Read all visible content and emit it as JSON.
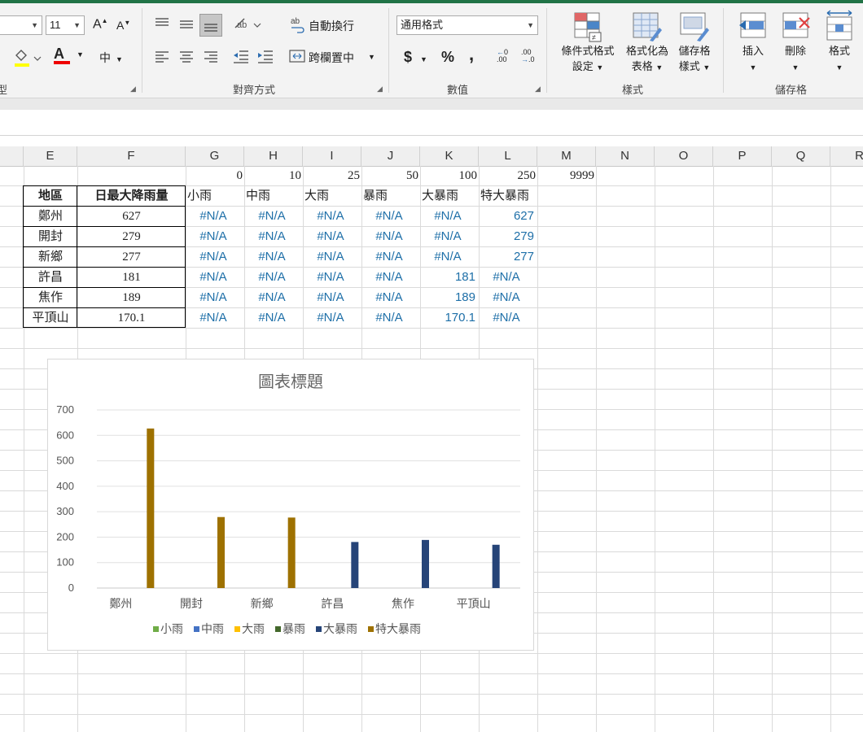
{
  "ribbon": {
    "font_size_value": "11",
    "increase_font_label": "A",
    "decrease_font_label": "A",
    "wrap_text_label": "自動換行",
    "merge_center_label": "跨欄置中",
    "number_format_value": "通用格式",
    "currency_label": "$",
    "percent_label": "%",
    "comma_label": ",",
    "inc_decimal_label": ".00",
    "dec_decimal_label": ".0",
    "phonetic_label": "中",
    "cond_format_line1": "條件式格式",
    "cond_format_line2": "設定",
    "format_table_line1": "格式化為",
    "format_table_line2": "表格",
    "cell_styles_line1": "儲存格",
    "cell_styles_line2": "樣式",
    "insert_label": "插入",
    "delete_label": "刪除",
    "format_label": "格式",
    "groups": {
      "font_partial": "型",
      "alignment": "對齊方式",
      "number": "數值",
      "styles": "樣式",
      "cells": "儲存格"
    }
  },
  "columns": [
    "E",
    "F",
    "G",
    "H",
    "I",
    "J",
    "K",
    "L",
    "M",
    "N",
    "O",
    "P",
    "Q",
    "R"
  ],
  "thresholds": [
    "0",
    "10",
    "25",
    "50",
    "100",
    "250",
    "9999"
  ],
  "table": {
    "header_region": "地區",
    "header_rain": "日最大降雨量",
    "category_headers": [
      "小雨",
      "中雨",
      "大雨",
      "暴雨",
      "大暴雨",
      "特大暴雨"
    ],
    "rows": [
      {
        "region": "鄭州",
        "rain": "627",
        "cats": [
          "#N/A",
          "#N/A",
          "#N/A",
          "#N/A",
          "#N/A",
          "627"
        ]
      },
      {
        "region": "開封",
        "rain": "279",
        "cats": [
          "#N/A",
          "#N/A",
          "#N/A",
          "#N/A",
          "#N/A",
          "279"
        ]
      },
      {
        "region": "新鄉",
        "rain": "277",
        "cats": [
          "#N/A",
          "#N/A",
          "#N/A",
          "#N/A",
          "#N/A",
          "277"
        ]
      },
      {
        "region": "許昌",
        "rain": "181",
        "cats": [
          "#N/A",
          "#N/A",
          "#N/A",
          "#N/A",
          "181",
          "#N/A"
        ]
      },
      {
        "region": "焦作",
        "rain": "189",
        "cats": [
          "#N/A",
          "#N/A",
          "#N/A",
          "#N/A",
          "189",
          "#N/A"
        ]
      },
      {
        "region": "平頂山",
        "rain": "170.1",
        "cats": [
          "#N/A",
          "#N/A",
          "#N/A",
          "#N/A",
          "170.1",
          "#N/A"
        ]
      }
    ]
  },
  "chart_data": {
    "type": "bar",
    "title": "圖表標題",
    "categories": [
      "鄭州",
      "開封",
      "新鄉",
      "許昌",
      "焦作",
      "平頂山"
    ],
    "ylim": [
      0,
      700
    ],
    "yticks": [
      0,
      100,
      200,
      300,
      400,
      500,
      600,
      700
    ],
    "grid": true,
    "legend_position": "bottom",
    "series": [
      {
        "name": "小雨",
        "color": "#70ad47",
        "values": [
          null,
          null,
          null,
          null,
          null,
          null
        ]
      },
      {
        "name": "中雨",
        "color": "#4472c4",
        "values": [
          null,
          null,
          null,
          null,
          null,
          null
        ]
      },
      {
        "name": "大雨",
        "color": "#ffc000",
        "values": [
          null,
          null,
          null,
          null,
          null,
          null
        ]
      },
      {
        "name": "暴雨",
        "color": "#43682b",
        "values": [
          null,
          null,
          null,
          null,
          null,
          null
        ]
      },
      {
        "name": "大暴雨",
        "color": "#264478",
        "values": [
          null,
          null,
          null,
          181,
          189,
          170.1
        ]
      },
      {
        "name": "特大暴雨",
        "color": "#9e7100",
        "values": [
          627,
          279,
          277,
          null,
          null,
          null
        ]
      }
    ]
  }
}
